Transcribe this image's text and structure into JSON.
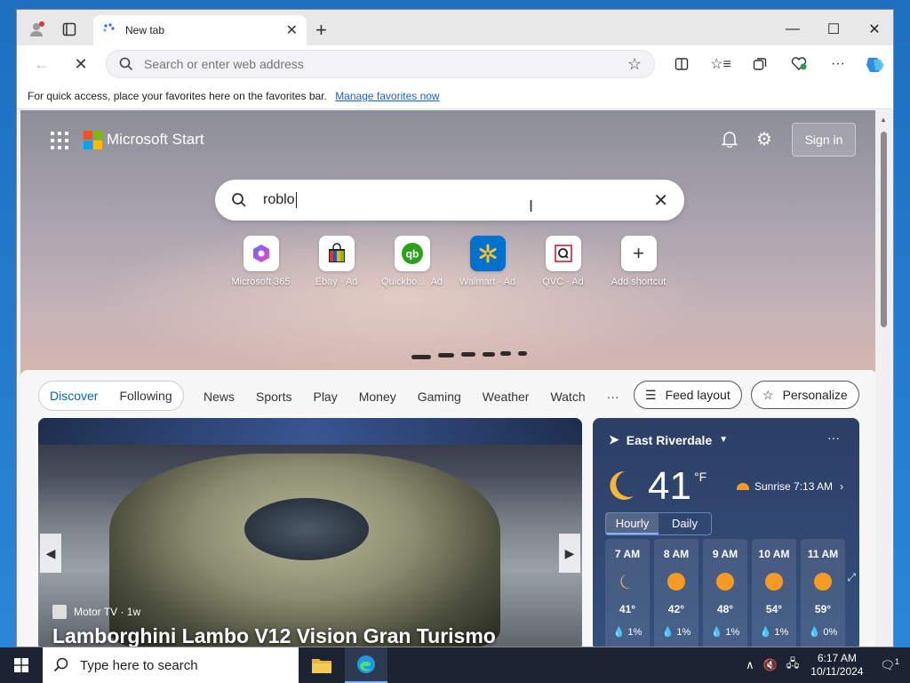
{
  "browser": {
    "tab_title": "New tab",
    "address_placeholder": "Search or enter web address",
    "favbar_text": "For quick access, place your favorites here on the favorites bar.",
    "favbar_link": "Manage favorites now"
  },
  "start": {
    "brand": "Microsoft Start",
    "sign_in": "Sign in",
    "search_query": "roblo",
    "shortcuts": [
      {
        "label": "Microsoft 365",
        "ad": ""
      },
      {
        "label": "Ebay",
        "ad": "· Ad"
      },
      {
        "label": "Quickbo...",
        "ad": "Ad"
      },
      {
        "label": "Walmart",
        "ad": "· Ad"
      },
      {
        "label": "QVC",
        "ad": "· Ad"
      },
      {
        "label": "Add shortcut",
        "ad": ""
      }
    ]
  },
  "feed": {
    "nav": [
      "Discover",
      "Following",
      "News",
      "Sports",
      "Play",
      "Money",
      "Gaming",
      "Weather",
      "Watch",
      "···"
    ],
    "feed_layout": "Feed layout",
    "personalize": "Personalize",
    "hero": {
      "source": "Motor TV",
      "age": "· 1w",
      "title": "Lamborghini Lambo V12 Vision Gran Turismo"
    }
  },
  "weather": {
    "location": "East Riverdale",
    "temp": "41",
    "unit": "°F",
    "sunrise": "Sunrise 7:13 AM",
    "tab_hourly": "Hourly",
    "tab_daily": "Daily",
    "hours": [
      {
        "time": "7 AM",
        "temp": "41°",
        "precip": "1%"
      },
      {
        "time": "8 AM",
        "temp": "42°",
        "precip": "1%"
      },
      {
        "time": "9 AM",
        "temp": "48°",
        "precip": "1%"
      },
      {
        "time": "10 AM",
        "temp": "54°",
        "precip": "1%"
      },
      {
        "time": "11 AM",
        "temp": "59°",
        "precip": "0%"
      }
    ]
  },
  "taskbar": {
    "search_placeholder": "Type here to search",
    "time": "6:17 AM",
    "date": "10/11/2024",
    "notif_count": "1"
  },
  "colors": {
    "accent": "#0067b8",
    "sun": "#f59a23"
  }
}
